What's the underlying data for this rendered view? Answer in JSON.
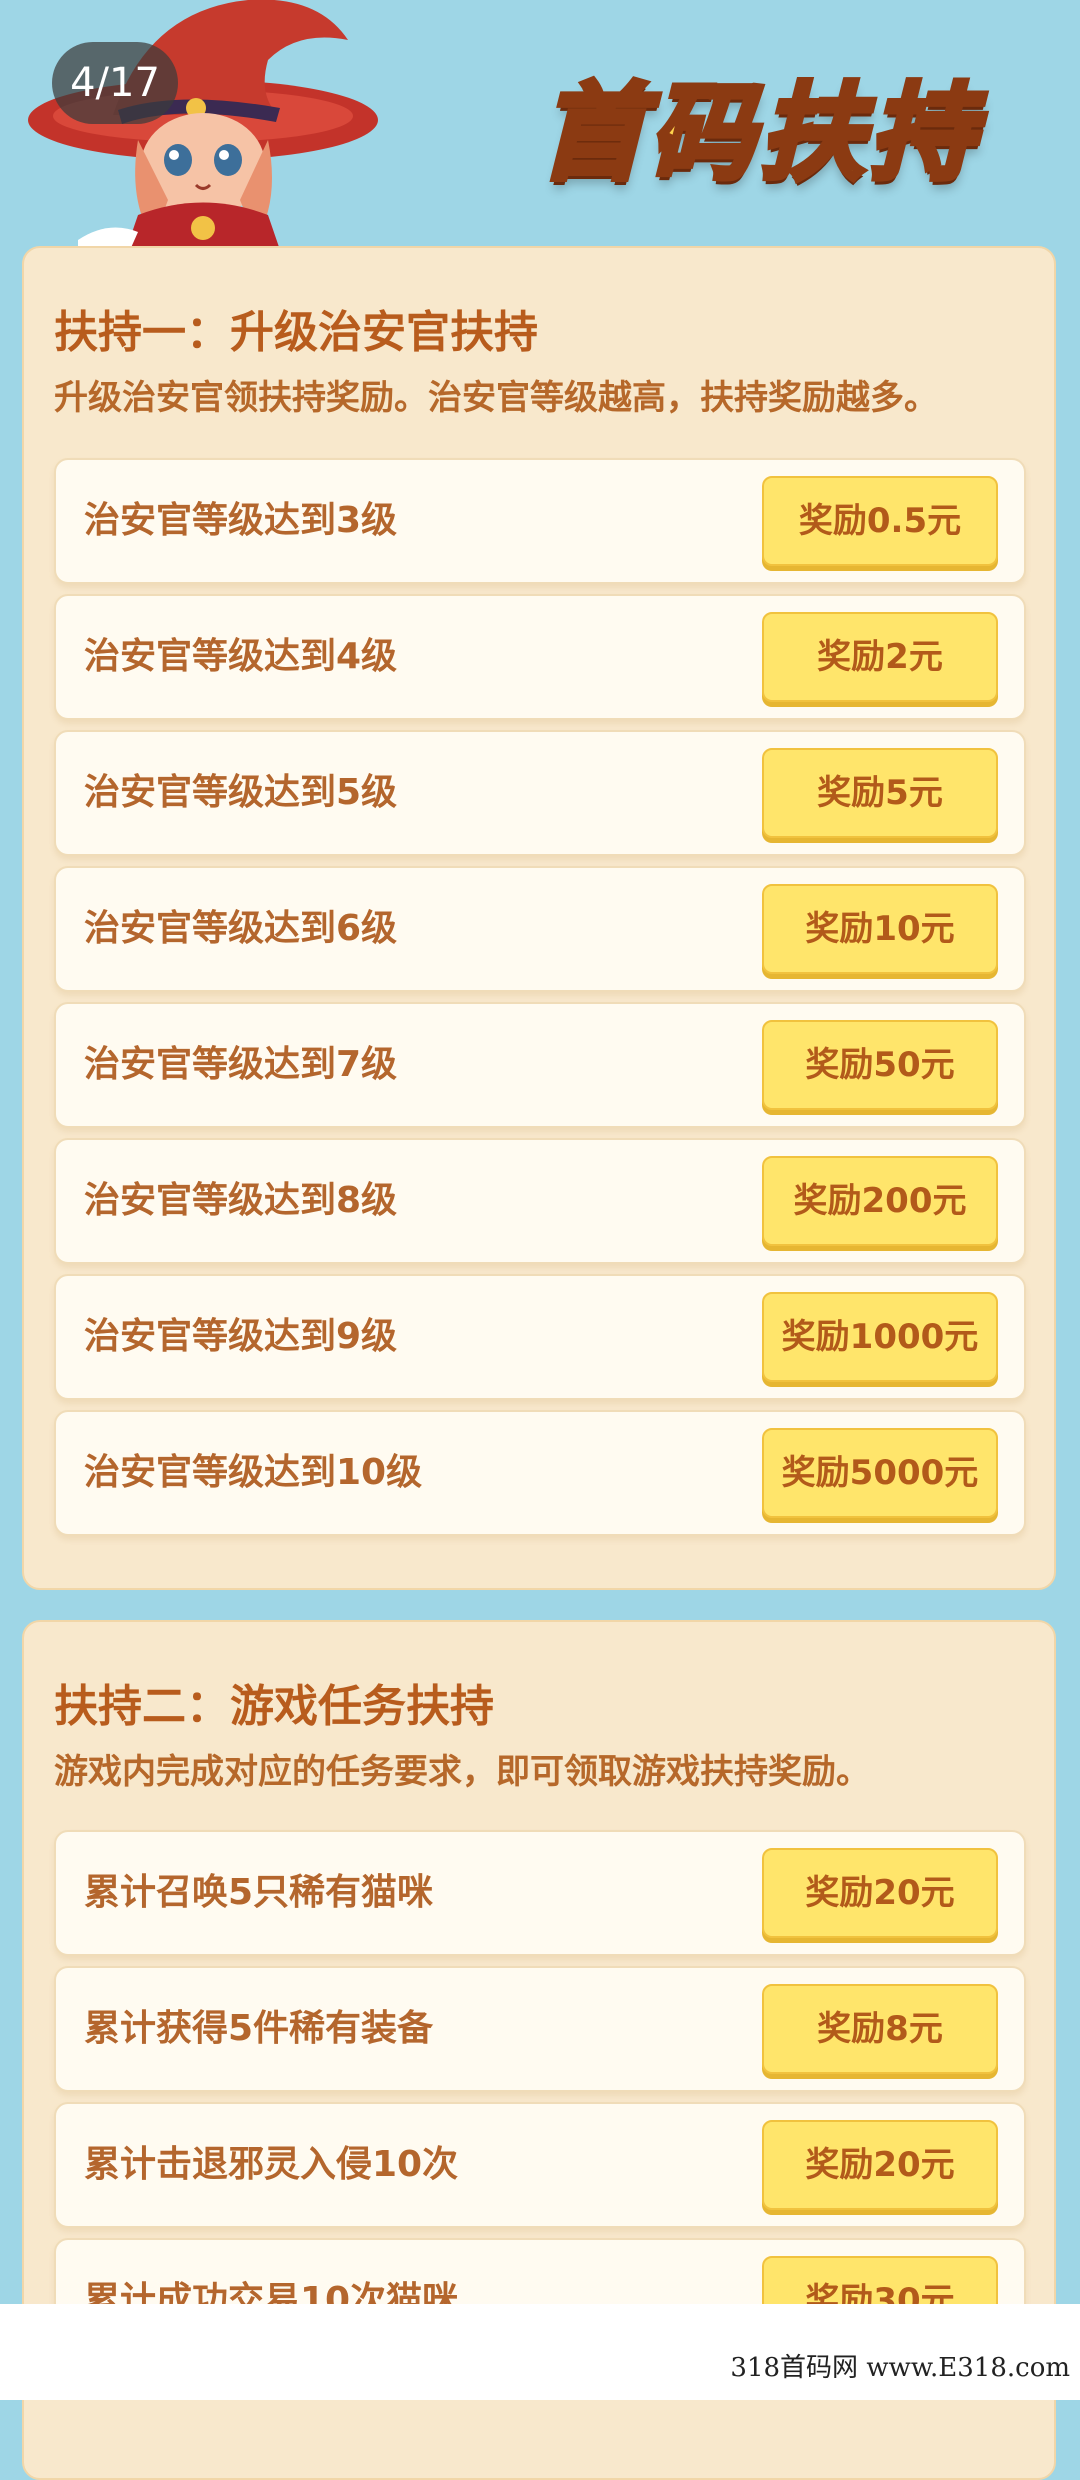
{
  "header": {
    "page_counter": "4/17",
    "title": "首码扶持"
  },
  "section1": {
    "title": "扶持一：升级治安官扶持",
    "description": "升级治安官领扶持奖励。治安官等级越高，扶持奖励越多。",
    "rows": [
      {
        "label": "治安官等级达到3级",
        "reward": "奖励0.5元"
      },
      {
        "label": "治安官等级达到4级",
        "reward": "奖励2元"
      },
      {
        "label": "治安官等级达到5级",
        "reward": "奖励5元"
      },
      {
        "label": "治安官等级达到6级",
        "reward": "奖励10元"
      },
      {
        "label": "治安官等级达到7级",
        "reward": "奖励50元"
      },
      {
        "label": "治安官等级达到8级",
        "reward": "奖励200元"
      },
      {
        "label": "治安官等级达到9级",
        "reward": "奖励1000元"
      },
      {
        "label": "治安官等级达到10级",
        "reward": "奖励5000元"
      }
    ]
  },
  "section2": {
    "title": "扶持二：游戏任务扶持",
    "description": "游戏内完成对应的任务要求，即可领取游戏扶持奖励。",
    "rows": [
      {
        "label": "累计召唤5只稀有猫咪",
        "reward": "奖励20元"
      },
      {
        "label": "累计获得5件稀有装备",
        "reward": "奖励8元"
      },
      {
        "label": "累计击退邪灵入侵10次",
        "reward": "奖励20元"
      },
      {
        "label": "累计成功交易10次猫咪",
        "reward": "奖励30元"
      }
    ]
  },
  "watermark": "318首码网 www.E318.com",
  "colors": {
    "background": "#9ed6e6",
    "panel": "#f8e8cc",
    "button": "#ffe56b",
    "text_brown": "#b4662d"
  }
}
